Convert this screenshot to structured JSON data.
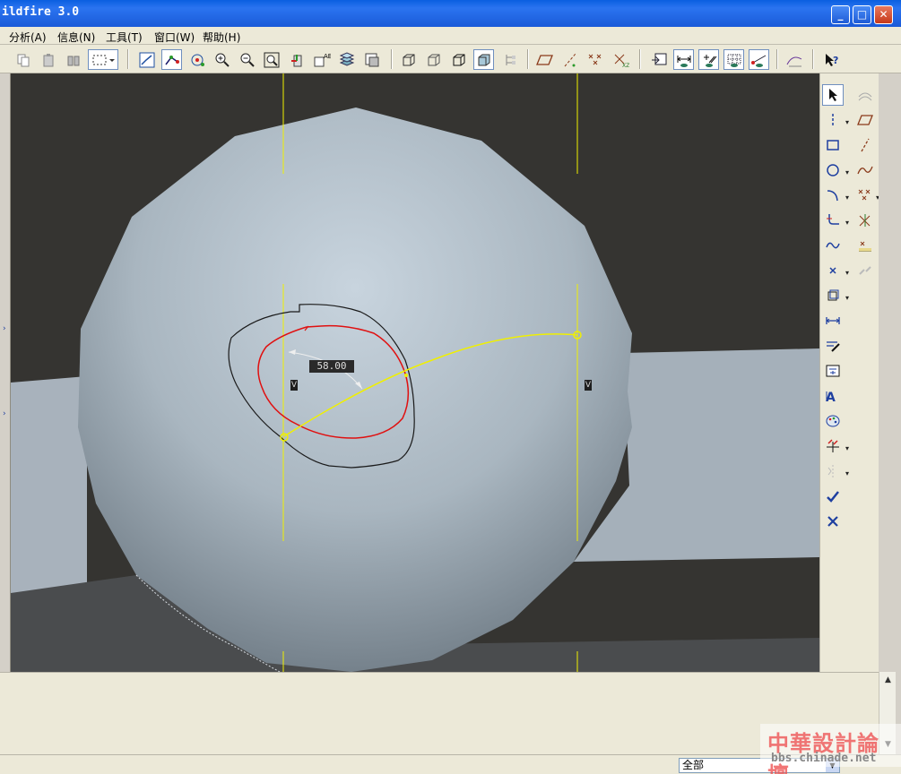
{
  "window": {
    "title": "ildfire 3.0"
  },
  "menu": [
    {
      "label": "分析(A)"
    },
    {
      "label": "信息(N)"
    },
    {
      "label": "工具(T)"
    },
    {
      "label": "窗口(W)"
    },
    {
      "label": "帮助(H)"
    }
  ],
  "sketch": {
    "dimension_label": "58.00",
    "vertical_constraint": "V"
  },
  "status": {
    "filter_value": "全部"
  },
  "watermark": {
    "title": "中華設計論壇",
    "url": "bbs.chinade.net"
  },
  "colors": {
    "sketch_yellow": "#f0f000",
    "selection_red": "#e01010",
    "outline_black": "#1a1a1a",
    "viewport_bg": "#353431"
  }
}
